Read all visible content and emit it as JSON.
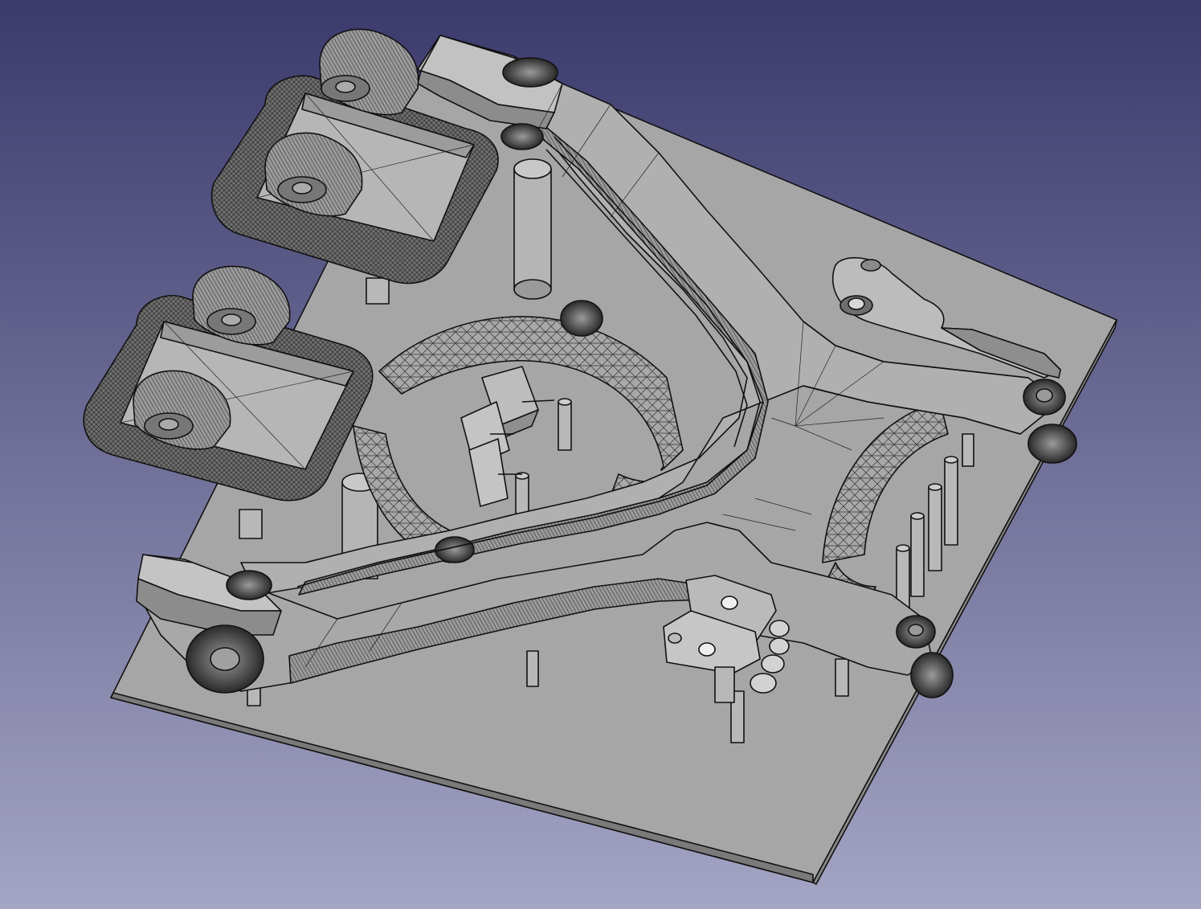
{
  "viewport": {
    "background_top": "#3b3a6c",
    "background_bottom": "#a4a4c4",
    "model_face": "#a8a8a8",
    "model_light": "#c2c2c2",
    "model_dark": "#8e8e8e",
    "edge_color": "#111111"
  },
  "model": {
    "components": [
      "base-plate",
      "y-frame",
      "gear-housing-upper",
      "gear-housing-lower",
      "hinge-bracket",
      "arc-mesh-left",
      "arc-mesh-right",
      "lever-arm",
      "pins"
    ]
  }
}
